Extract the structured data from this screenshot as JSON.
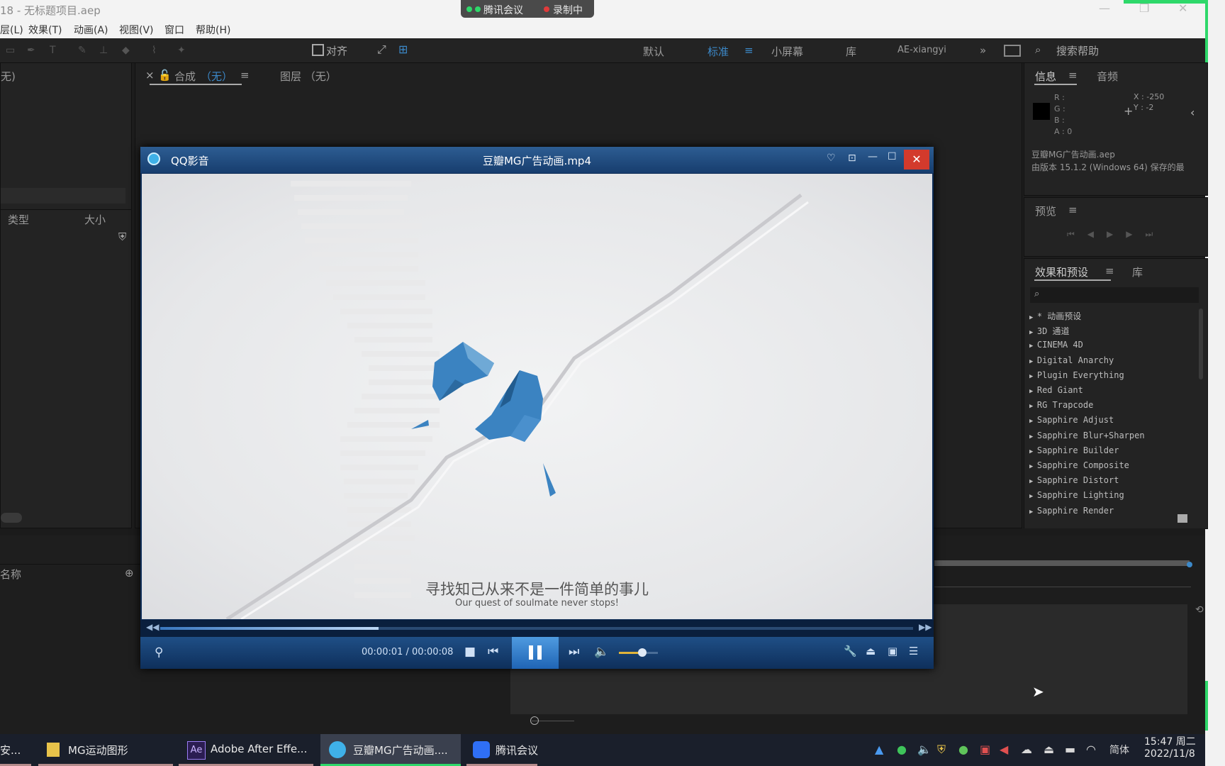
{
  "window": {
    "title": "18 - 无标题项目.aep",
    "meeting_badge_left": "腾讯会议",
    "meeting_badge_right": "录制中"
  },
  "menu": [
    "层(L)",
    "效果(T)",
    "动画(A)",
    "视图(V)",
    "窗口",
    "帮助(H)"
  ],
  "toolbar": {
    "align_label": "对齐",
    "workspaces": [
      "默认",
      "标准",
      "小屏幕",
      "库",
      "AE-xiangyi"
    ],
    "active_workspace": "标准",
    "more": "»",
    "search_placeholder": "搜索帮助"
  },
  "project_panel": {
    "header_fragment": "无)",
    "col_type": "类型",
    "col_size": "大小"
  },
  "comp_panel": {
    "tab_comp": "合成",
    "tab_comp_value": "（无）",
    "tab_layer": "图层 （无）"
  },
  "info_panel": {
    "tab_info": "信息",
    "tab_audio": "音频",
    "r_label": "R :",
    "g_label": "G :",
    "b_label": "B :",
    "a_label": "A : 0",
    "x_label": "X : -250",
    "y_label": "Y : -2",
    "file_line": "豆瓣MG广告动画.aep",
    "version_line": "由版本 15.1.2 (Windows 64) 保存的最"
  },
  "preview_panel": {
    "title": "预览"
  },
  "effects_panel": {
    "tab_effects": "效果和预设",
    "tab_library": "库",
    "items": [
      "* 动画预设",
      "3D 通道",
      "CINEMA 4D",
      "Digital Anarchy",
      "Plugin Everything",
      "Red Giant",
      "RG Trapcode",
      "Sapphire Adjust",
      "Sapphire Blur+Sharpen",
      "Sapphire Builder",
      "Sapphire Composite",
      "Sapphire Distort",
      "Sapphire Lighting",
      "Sapphire Render"
    ]
  },
  "timeline_panel": {
    "col_name": "名称"
  },
  "player": {
    "app_name": "QQ影音",
    "file_name": "豆瓣MG广告动画.mp4",
    "subtitle_cn": "寻找知己从来不是一件简单的事儿",
    "subtitle_en": "Our quest of soulmate never stops!",
    "time": "00:00:01 / 00:00:08",
    "progress": 0.29,
    "volume": 0.6
  },
  "taskbar": {
    "apps": [
      {
        "label": "安..."
      },
      {
        "label": "MG运动图形"
      },
      {
        "label": "Adobe After Effe..."
      },
      {
        "label": "豆瓣MG广告动画...."
      },
      {
        "label": "腾讯会议"
      }
    ],
    "ime": "简体",
    "time": "15:47 周二",
    "date": "2022/11/8"
  },
  "colors": {
    "accent_blue": "#3c89c9",
    "ae_bg": "#232323",
    "player_blue": "#173d6e",
    "close_red": "#d33a2c",
    "recording_green": "#2ed86a"
  }
}
